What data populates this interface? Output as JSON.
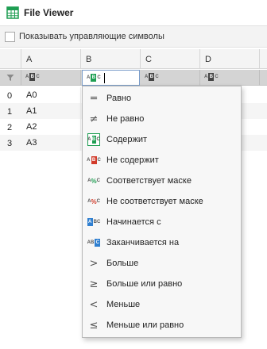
{
  "window": {
    "title": "File Viewer",
    "icon": "table-icon",
    "accent": "#1e9e52"
  },
  "toolbar": {
    "show_control_chars_label": "Показывать управляющие символы",
    "show_control_chars_checked": false
  },
  "grid": {
    "columns": [
      "A",
      "B",
      "C",
      "D"
    ],
    "rows": [
      {
        "num": "0",
        "a": "A0"
      },
      {
        "num": "1",
        "a": "A1"
      },
      {
        "num": "2",
        "a": "A2"
      },
      {
        "num": "3",
        "a": "A3"
      }
    ]
  },
  "filter_menu": {
    "items": [
      {
        "label": "Равно",
        "icon": "equals-icon"
      },
      {
        "label": "Не равно",
        "icon": "not-equals-icon"
      },
      {
        "label": "Содержит",
        "icon": "contains-icon",
        "selected": true
      },
      {
        "label": "Не содержит",
        "icon": "not-contains-icon"
      },
      {
        "label": "Соответствует маске",
        "icon": "matches-mask-icon"
      },
      {
        "label": "Не соответствует маске",
        "icon": "not-matches-mask-icon"
      },
      {
        "label": "Начинается с",
        "icon": "starts-with-icon"
      },
      {
        "label": "Заканчивается на",
        "icon": "ends-with-icon"
      },
      {
        "label": "Больше",
        "icon": "greater-than-icon"
      },
      {
        "label": "Больше или равно",
        "icon": "greater-or-equal-icon"
      },
      {
        "label": "Меньше",
        "icon": "less-than-icon"
      },
      {
        "label": "Меньше или равно",
        "icon": "less-or-equal-icon"
      }
    ]
  }
}
